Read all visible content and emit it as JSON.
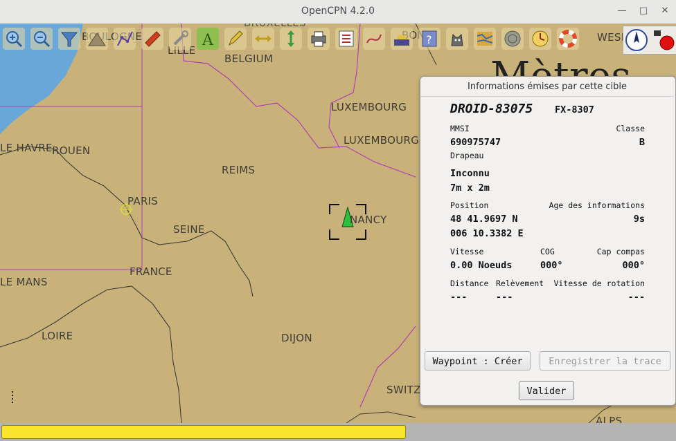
{
  "window": {
    "title": "OpenCPN 4.2.0",
    "controls": {
      "minimize": "—",
      "maximize": "□",
      "close": "✕"
    }
  },
  "map": {
    "labels": [
      {
        "id": "boulogne",
        "text": "BOULOGNE"
      },
      {
        "id": "lille",
        "text": "LILLE"
      },
      {
        "id": "belgium",
        "text": "BELGIUM"
      },
      {
        "id": "bruxelles",
        "text": "BRUXELLES"
      },
      {
        "id": "bonn",
        "text": "BONN"
      },
      {
        "id": "wesel",
        "text": "WESEL"
      },
      {
        "id": "luxembourg1",
        "text": "LUXEMBOURG"
      },
      {
        "id": "luxembourg2",
        "text": "LUXEMBOURG"
      },
      {
        "id": "lehavre",
        "text": "LE HAVRE"
      },
      {
        "id": "rouen",
        "text": "ROUEN"
      },
      {
        "id": "reims",
        "text": "REIMS"
      },
      {
        "id": "paris",
        "text": "PARIS"
      },
      {
        "id": "seine",
        "text": "SEINE"
      },
      {
        "id": "nancy",
        "text": "NANCY"
      },
      {
        "id": "france",
        "text": "FRANCE"
      },
      {
        "id": "lemans",
        "text": "LE MANS"
      },
      {
        "id": "loire",
        "text": "LOIRE"
      },
      {
        "id": "dijon",
        "text": "DIJON"
      },
      {
        "id": "switz",
        "text": "SWITZ"
      },
      {
        "id": "alps",
        "text": "ALPS"
      },
      {
        "id": "metres",
        "text": "Mètres"
      }
    ]
  },
  "toolbar": {
    "buttons": [
      {
        "name": "zoom-in",
        "icon": "zoom-in-icon"
      },
      {
        "name": "zoom-out",
        "icon": "zoom-out-icon"
      },
      {
        "name": "chart-quilt",
        "icon": "funnel-icon"
      },
      {
        "name": "scale-in",
        "icon": "mountain-icon"
      },
      {
        "name": "route",
        "icon": "route-icon"
      },
      {
        "name": "tracking",
        "icon": "boat-icon"
      },
      {
        "name": "tools",
        "icon": "wrench-icon"
      },
      {
        "name": "text",
        "icon": "text-a-icon"
      },
      {
        "name": "draw",
        "icon": "pencil-icon"
      },
      {
        "name": "resize-h",
        "icon": "arrows-horizontal-icon"
      },
      {
        "name": "resize-v",
        "icon": "arrows-vertical-icon"
      },
      {
        "name": "print",
        "icon": "printer-icon"
      },
      {
        "name": "route-manager",
        "icon": "checklist-icon"
      },
      {
        "name": "track",
        "icon": "track-icon"
      },
      {
        "name": "mob-boat",
        "icon": "ship-icon"
      },
      {
        "name": "help",
        "icon": "help-icon"
      },
      {
        "name": "dog",
        "icon": "dog-icon"
      },
      {
        "name": "tide",
        "icon": "tide-map-icon"
      },
      {
        "name": "current",
        "icon": "globe-icon"
      },
      {
        "name": "clock",
        "icon": "clock-icon"
      },
      {
        "name": "lifebuoy",
        "icon": "lifebuoy-icon"
      }
    ]
  },
  "dialog": {
    "title": "Informations émises par cette cible",
    "vessel_name": "DROID-83075",
    "callsign": "FX-8307",
    "mmsi_label": "MMSI",
    "mmsi_value": "690975747",
    "class_label": "Classe",
    "class_value": "B",
    "flag_label": "Drapeau",
    "flag_value": "Inconnu",
    "size_value": "7m x 2m",
    "position_label": "Position",
    "age_label": "Age des informations",
    "lat_value": "48 41.9697 N",
    "lon_value": "006 10.3382 E",
    "age_value": "9s",
    "speed_label": "Vitesse",
    "cog_label": "COG",
    "heading_label": "Cap compas",
    "speed_value": "0.00 Noeuds",
    "cog_value": "000°",
    "heading_value": "000°",
    "distance_label": "Distance",
    "bearing_label": "Relèvement",
    "rot_label": "Vitesse de rotation",
    "distance_value": "---",
    "bearing_value": "---",
    "rot_value": "---",
    "waypoint_button": "Waypoint : Créer",
    "track_button": "Enregistrer la trace",
    "ok_button": "Valider"
  },
  "status": {
    "progress_fraction": 0.6
  },
  "colors": {
    "land": "#c9b27a",
    "water": "#6aa7d9",
    "boundary": "#b040b0",
    "progress": "#f7e62b"
  }
}
